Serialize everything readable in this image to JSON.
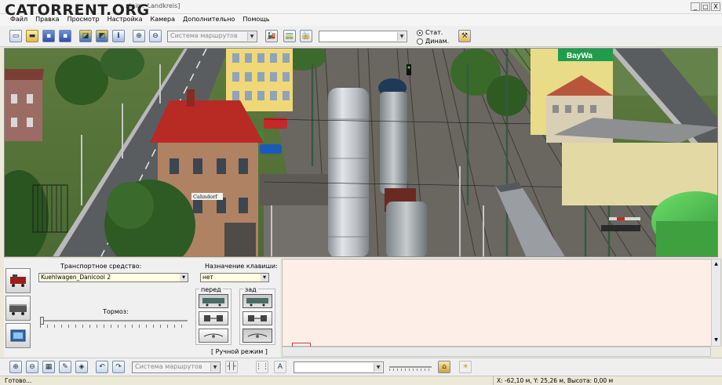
{
  "watermark": "CATORRENT.ORG",
  "window": {
    "title": "steins_Landkreis]",
    "minimize": "_",
    "maximize": "□",
    "close": "X"
  },
  "menu": {
    "items": [
      "Файл",
      "Правка",
      "Просмотр",
      "Настройка",
      "Камера",
      "Дополнительно",
      "Помощь"
    ]
  },
  "toolbar": {
    "route_system": "Система маршрутов",
    "route_select": "",
    "radio_static": "Стат.",
    "radio_dynamic": "Динам.",
    "static_selected": true
  },
  "viewport": {
    "sign_bay": "BayWa",
    "sign_station": "Cahndorf"
  },
  "panel": {
    "vehicle_label": "Транспортное средство:",
    "vehicle_value": "Kuehlwagen_Danicool 2",
    "key_label": "Назначение клавиши:",
    "key_value": "нет",
    "brake_label": "Тормоз:",
    "front_label": "перед",
    "back_label": "зад",
    "mode_label": "[ Ручной режим ]"
  },
  "bottom_toolbar": {
    "route_system": "Система маршрутов",
    "font_select": ""
  },
  "status": {
    "left": "Готово...",
    "right": "X: -62,10 м, Y: 25,26 м, Высота: 0,00 м"
  },
  "colors": {
    "log_bg": "#fdefe8",
    "bay_sign": "#1f9c4c",
    "roof_red": "#b82a24"
  }
}
